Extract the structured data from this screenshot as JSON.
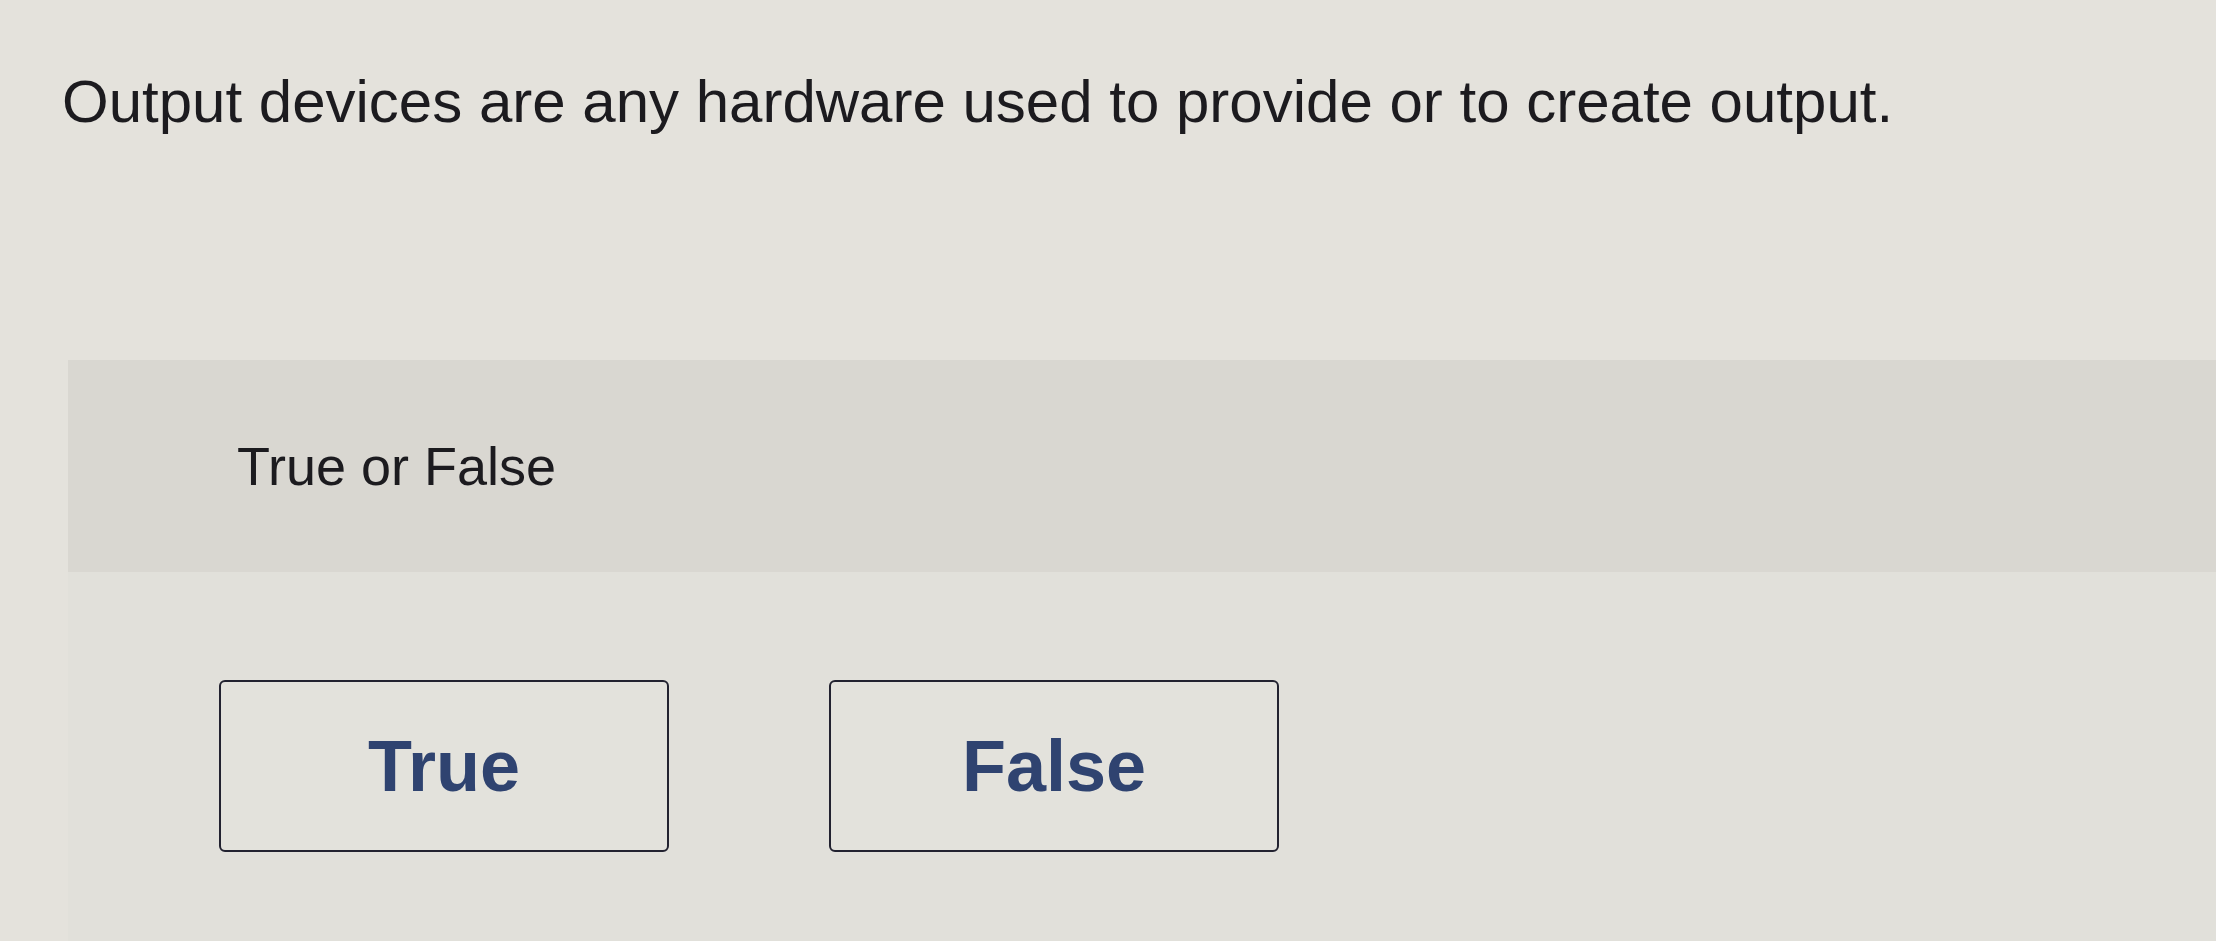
{
  "question": {
    "text": "Output devices are any hardware used to provide or to create output."
  },
  "answer_card": {
    "prompt": "True or False",
    "choices": [
      {
        "label": "True",
        "selected": false
      },
      {
        "label": "False",
        "selected": false
      }
    ]
  }
}
